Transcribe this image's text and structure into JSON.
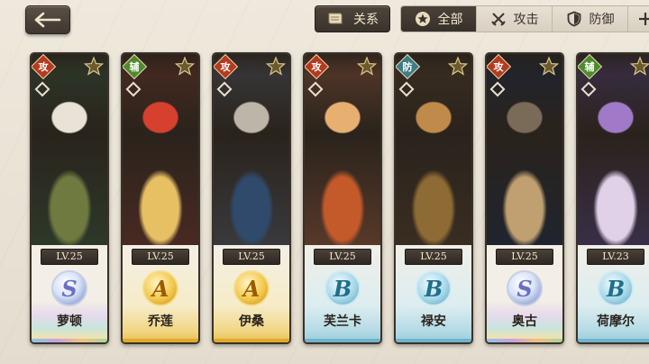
{
  "header": {
    "back_icon": "back-arrow-icon",
    "relation_label": "关系",
    "relation_icon": "scroll-icon"
  },
  "tabs": [
    {
      "label": "全部",
      "icon": "star-badge-icon",
      "active": true
    },
    {
      "label": "攻击",
      "icon": "crossed-swords-icon",
      "active": false
    },
    {
      "label": "防御",
      "icon": "shield-icon",
      "active": false
    },
    {
      "label": "",
      "icon": "cross-icon",
      "active": false
    }
  ],
  "characters": [
    {
      "role": "攻",
      "role_type": "attack",
      "level": "LV.25",
      "rank": "S",
      "name": "萝顿",
      "frame": "rainbow",
      "art_colors": [
        "#2d3a2a",
        "#e8e3d6",
        "#6e7a3f"
      ]
    },
    {
      "role": "辅",
      "role_type": "support",
      "level": "LV.25",
      "rank": "A",
      "name": "乔莲",
      "frame": "gold",
      "art_colors": [
        "#4a2a22",
        "#d6402f",
        "#e7c064"
      ]
    },
    {
      "role": "攻",
      "role_type": "attack",
      "level": "LV.25",
      "rank": "A",
      "name": "伊桑",
      "frame": "gold",
      "art_colors": [
        "#3a3a3e",
        "#bdb6a8",
        "#2f4a6a"
      ]
    },
    {
      "role": "攻",
      "role_type": "attack",
      "level": "LV.25",
      "rank": "B",
      "name": "芙兰卡",
      "frame": "blue",
      "art_colors": [
        "#5a3a2a",
        "#e8b070",
        "#c45a2a"
      ]
    },
    {
      "role": "防",
      "role_type": "defense",
      "level": "LV.25",
      "rank": "B",
      "name": "禄安",
      "frame": "blue",
      "art_colors": [
        "#3a2e22",
        "#c08a4a",
        "#8e6b34"
      ]
    },
    {
      "role": "攻",
      "role_type": "attack",
      "level": "LV.25",
      "rank": "S",
      "name": "奥古",
      "frame": "rainbow",
      "art_colors": [
        "#1f2430",
        "#7a6a58",
        "#c0a070"
      ]
    },
    {
      "role": "辅",
      "role_type": "support",
      "level": "LV.23",
      "rank": "B",
      "name": "荷摩尔",
      "frame": "blue",
      "art_colors": [
        "#3a2f4a",
        "#a07ac8",
        "#e0d0e8"
      ]
    }
  ]
}
